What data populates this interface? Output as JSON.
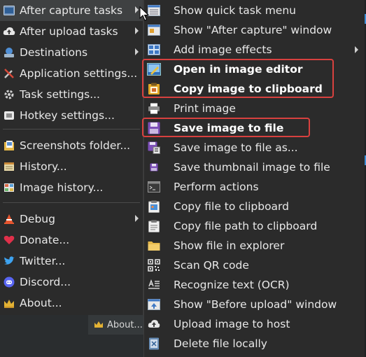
{
  "main_menu": {
    "items": [
      {
        "label": "After capture tasks",
        "icon": "after-capture-icon",
        "submenu": true,
        "hover": true
      },
      {
        "label": "After upload tasks",
        "icon": "after-upload-icon",
        "submenu": true
      },
      {
        "label": "Destinations",
        "icon": "destinations-icon",
        "submenu": true
      },
      {
        "label": "Application settings...",
        "icon": "application-settings-icon"
      },
      {
        "label": "Task settings...",
        "icon": "task-settings-icon"
      },
      {
        "label": "Hotkey settings...",
        "icon": "hotkey-settings-icon"
      },
      {
        "label": "Screenshots folder...",
        "icon": "screenshots-folder-icon"
      },
      {
        "label": "History...",
        "icon": "history-icon"
      },
      {
        "label": "Image history...",
        "icon": "image-history-icon"
      },
      {
        "label": "Debug",
        "icon": "debug-icon",
        "submenu": true
      },
      {
        "label": "Donate...",
        "icon": "donate-heart-icon"
      },
      {
        "label": "Twitter...",
        "icon": "twitter-icon"
      },
      {
        "label": "Discord...",
        "icon": "discord-icon"
      },
      {
        "label": "About...",
        "icon": "about-crown-icon"
      }
    ]
  },
  "submenu": {
    "items": [
      {
        "label": "Show quick task menu",
        "icon": "quick-task-menu-icon"
      },
      {
        "label": "Show \"After capture\" window",
        "icon": "after-capture-window-icon"
      },
      {
        "label": "Add image effects",
        "icon": "image-effects-icon",
        "submenu": true
      },
      {
        "label": "Open in image editor",
        "icon": "image-editor-icon",
        "bold": true
      },
      {
        "label": "Copy image to clipboard",
        "icon": "copy-image-clipboard-icon",
        "bold": true
      },
      {
        "label": "Print image",
        "icon": "printer-icon"
      },
      {
        "label": "Save image to file",
        "icon": "save-floppy-icon",
        "bold": true
      },
      {
        "label": "Save image to file as...",
        "icon": "save-as-icon"
      },
      {
        "label": "Save thumbnail image to file",
        "icon": "save-thumbnail-icon"
      },
      {
        "label": "Perform actions",
        "icon": "terminal-icon"
      },
      {
        "label": "Copy file to clipboard",
        "icon": "copy-file-icon"
      },
      {
        "label": "Copy file path to clipboard",
        "icon": "copy-path-icon"
      },
      {
        "label": "Show file in explorer",
        "icon": "folder-explorer-icon"
      },
      {
        "label": "Scan QR code",
        "icon": "qr-code-icon"
      },
      {
        "label": "Recognize text (OCR)",
        "icon": "ocr-text-icon"
      },
      {
        "label": "Show \"Before upload\" window",
        "icon": "before-upload-window-icon"
      },
      {
        "label": "Upload image to host",
        "icon": "cloud-upload-icon"
      },
      {
        "label": "Delete file locally",
        "icon": "delete-file-icon"
      }
    ]
  },
  "background": {
    "about_label": "About..."
  },
  "colors": {
    "menu_bg": "#2b2b2b",
    "hover_bg": "#3f4142",
    "highlight_border": "#d8413f",
    "text": "#e8e8e8"
  }
}
